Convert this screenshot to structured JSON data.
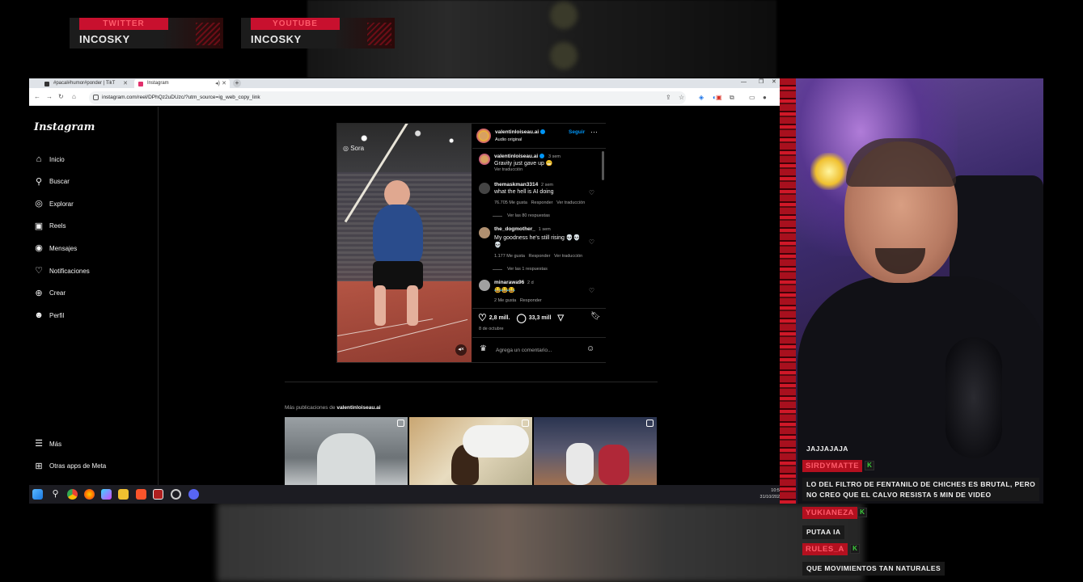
{
  "overlay": {
    "socials": [
      {
        "platform": "TWITTER",
        "user": "INCOSKY"
      },
      {
        "platform": "YOUTUBE",
        "user": "INCOSKY"
      }
    ]
  },
  "browser": {
    "tabs": [
      {
        "label": "#pacal#humor#ponder | TikT",
        "color": "#333333"
      },
      {
        "label": "Instagram",
        "color": "#e1306c"
      }
    ],
    "url": "instagram.com/reel/DPhQz2uDUzc/?utm_source=ig_web_copy_link",
    "new_tab_label": "+"
  },
  "instagram": {
    "logo": "Instagram",
    "nav": [
      {
        "label": "Inicio",
        "icon": "home-icon",
        "glyph": "⌂"
      },
      {
        "label": "Buscar",
        "icon": "search-icon",
        "glyph": "⚲"
      },
      {
        "label": "Explorar",
        "icon": "compass-icon",
        "glyph": "◎"
      },
      {
        "label": "Reels",
        "icon": "reels-icon",
        "glyph": "▣"
      },
      {
        "label": "Mensajes",
        "icon": "messenger-icon",
        "glyph": "◉"
      },
      {
        "label": "Notificaciones",
        "icon": "heart-icon",
        "glyph": "♡"
      },
      {
        "label": "Crear",
        "icon": "plus-square-icon",
        "glyph": "⊕"
      },
      {
        "label": "Perfil",
        "icon": "profile-icon",
        "glyph": "☻"
      }
    ],
    "nav_bottom": [
      {
        "label": "Más",
        "icon": "menu-icon",
        "glyph": "☰"
      },
      {
        "label": "Otras apps de Meta",
        "icon": "meta-apps-icon",
        "glyph": "⊞"
      }
    ],
    "post": {
      "video_watermark": "Sora",
      "author": "valentinloiseau.ai",
      "audio": "Audio original",
      "follow": "Seguir",
      "caption": {
        "user": "valentinloiseau.ai",
        "time": "3 sem",
        "text": "Gravity just gave up 😁",
        "translate": "Ver traducción"
      },
      "comments": [
        {
          "user": "themaskman3314",
          "time": "2 sem",
          "text": "what the hell is AI doing",
          "likes": "76.705 Me gusta",
          "reply": "Responder",
          "translate": "Ver traducción",
          "replies": "Ver las 80 respuestas",
          "avatar_color": "#444444"
        },
        {
          "user": "the_dogmother_",
          "time": "1 sem",
          "text": "My goodness he's still rising 💀💀💀",
          "likes": "1.177 Me gusta",
          "reply": "Responder",
          "translate": "Ver traducción",
          "replies": "Ver las 1 respuestas",
          "avatar_color": "#b09070"
        },
        {
          "user": "minarawa96",
          "time": "2 d",
          "text": "😂😂😂",
          "likes": "2 Me gusta",
          "reply": "Responder",
          "avatar_color": "#a0a0a0"
        }
      ],
      "like_count": "2,8 mill.",
      "comment_count": "33,3 mill",
      "date": "8 de octubre",
      "comment_placeholder": "Agrega un comentario..."
    },
    "more_title_prefix": "Más publicaciones de ",
    "more_title_user": "valentinloiseau.ai"
  },
  "taskbar": {
    "time": "10:5",
    "date": "31/10/202"
  },
  "chat": [
    {
      "type": "msg",
      "text": "JAJJAJAJA"
    },
    {
      "type": "user",
      "name": "SIRDYMATTE"
    },
    {
      "type": "msg",
      "text": "LO DEL FILTRO DE FENTANILO DE CHICHES ES BRUTAL, PERO\nNO CREO QUE EL CALVO RESISTA 5 MIN DE VIDEO"
    },
    {
      "type": "user",
      "name": "YUKIANEZA"
    },
    {
      "type": "msg",
      "text": "PUTAA IA"
    },
    {
      "type": "user",
      "name": "RULES_A"
    },
    {
      "type": "msg",
      "text": "QUE MOVIMIENTOS TAN NATURALES"
    }
  ],
  "chat_badge": "K"
}
